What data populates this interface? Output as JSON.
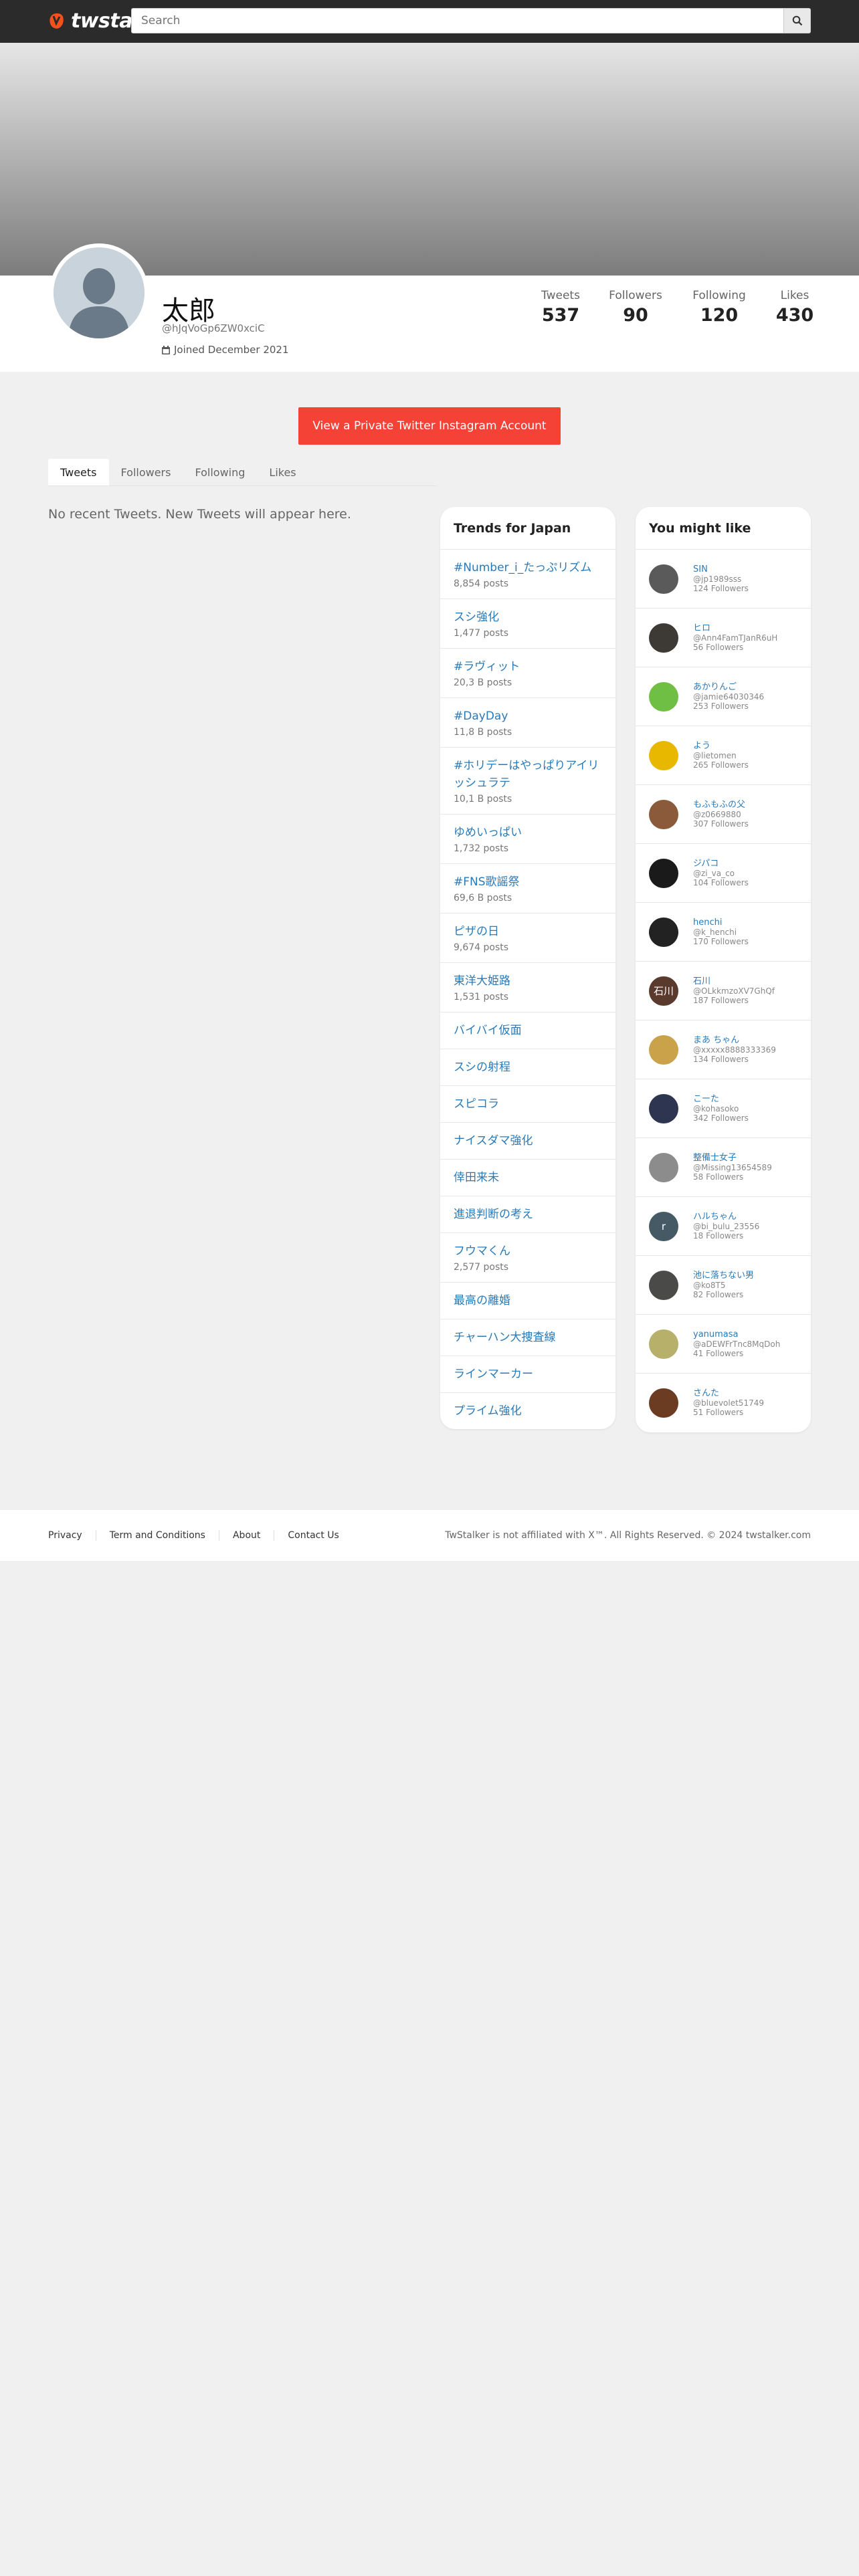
{
  "nav": {
    "logo_text": "twstalker",
    "search_placeholder": "Search",
    "brand_color": "#f4511e"
  },
  "profile": {
    "name": "太郎",
    "handle": "@hJqVoGp6ZW0xciC",
    "joined": "Joined December 2021",
    "stats": [
      {
        "label": "Tweets",
        "value": "537"
      },
      {
        "label": "Followers",
        "value": "90"
      },
      {
        "label": "Following",
        "value": "120"
      },
      {
        "label": "Likes",
        "value": "430"
      }
    ]
  },
  "cta": {
    "label": "View a Private Twitter Instagram Account",
    "color": "#f44336"
  },
  "tabs": [
    {
      "label": "Tweets",
      "active": true
    },
    {
      "label": "Followers",
      "active": false
    },
    {
      "label": "Following",
      "active": false
    },
    {
      "label": "Likes",
      "active": false
    }
  ],
  "timeline": {
    "empty_message": "No recent Tweets. New Tweets will appear here."
  },
  "trends": {
    "title": "Trends for Japan",
    "items": [
      {
        "name": "#Number_i_たっぷリズム",
        "posts": "8,854 posts"
      },
      {
        "name": "スシ強化",
        "posts": "1,477 posts"
      },
      {
        "name": "#ラヴィット",
        "posts": "20,3 B posts"
      },
      {
        "name": "#DayDay",
        "posts": "11,8 B posts"
      },
      {
        "name": "#ホリデーはやっぱりアイリッシュラテ",
        "posts": "10,1 B posts"
      },
      {
        "name": "ゆめいっぱい",
        "posts": "1,732 posts"
      },
      {
        "name": "#FNS歌謡祭",
        "posts": "69,6 B posts"
      },
      {
        "name": "ピザの日",
        "posts": "9,674 posts"
      },
      {
        "name": "東洋大姫路",
        "posts": "1,531 posts"
      },
      {
        "name": "バイバイ仮面",
        "posts": ""
      },
      {
        "name": "スシの射程",
        "posts": ""
      },
      {
        "name": "スピコラ",
        "posts": ""
      },
      {
        "name": "ナイスダマ強化",
        "posts": ""
      },
      {
        "name": "倖田来未",
        "posts": ""
      },
      {
        "name": "進退判断の考え",
        "posts": ""
      },
      {
        "name": "フウマくん",
        "posts": "2,577 posts"
      },
      {
        "name": "最高の離婚",
        "posts": ""
      },
      {
        "name": "チャーハン大捜査線",
        "posts": ""
      },
      {
        "name": "ラインマーカー",
        "posts": ""
      },
      {
        "name": "プライム強化",
        "posts": ""
      }
    ]
  },
  "suggestions": {
    "title": "You might like",
    "users": [
      {
        "name": "SIN",
        "handle": "@jp1989sss",
        "followers": "124 Followers",
        "avatar_color": "#5a5a5a",
        "initial": ""
      },
      {
        "name": "ヒロ",
        "handle": "@Ann4FamTJanR6uH",
        "followers": "56 Followers",
        "avatar_color": "#3d3a36",
        "initial": ""
      },
      {
        "name": "あかりんご",
        "handle": "@jamie64030346",
        "followers": "253 Followers",
        "avatar_color": "#6fbf45",
        "initial": ""
      },
      {
        "name": "よう",
        "handle": "@lietomen",
        "followers": "265 Followers",
        "avatar_color": "#e8b800",
        "initial": ""
      },
      {
        "name": "もふもふの父",
        "handle": "@z0669880",
        "followers": "307 Followers",
        "avatar_color": "#8a5a3a",
        "initial": ""
      },
      {
        "name": "ジパコ",
        "handle": "@zi_va_co",
        "followers": "104 Followers",
        "avatar_color": "#1a1a1a",
        "initial": ""
      },
      {
        "name": "henchi",
        "handle": "@k_henchi",
        "followers": "170 Followers",
        "avatar_color": "#222222",
        "initial": ""
      },
      {
        "name": "石川",
        "handle": "@OLkkmzoXV7GhQf",
        "followers": "187 Followers",
        "avatar_color": "#5b3a2e",
        "initial": "石川"
      },
      {
        "name": "まあ ちゃん",
        "handle": "@xxxxx8888333369",
        "followers": "134 Followers",
        "avatar_color": "#c9a24a",
        "initial": ""
      },
      {
        "name": "こーた",
        "handle": "@kohasoko",
        "followers": "342 Followers",
        "avatar_color": "#2d3550",
        "initial": ""
      },
      {
        "name": "整備士女子",
        "handle": "@Missing13654589",
        "followers": "58 Followers",
        "avatar_color": "#8c8c8c",
        "initial": ""
      },
      {
        "name": "ハルちゃん",
        "handle": "@bi_bulu_23556",
        "followers": "18 Followers",
        "avatar_color": "#455a64",
        "initial": "r"
      },
      {
        "name": "池に落ちない男",
        "handle": "@ko8T5",
        "followers": "82 Followers",
        "avatar_color": "#4a4a48",
        "initial": ""
      },
      {
        "name": "yanumasa",
        "handle": "@aDEWFrTnc8MqDoh",
        "followers": "41 Followers",
        "avatar_color": "#b6b06a",
        "initial": ""
      },
      {
        "name": "さんた",
        "handle": "@bluevolet51749",
        "followers": "51 Followers",
        "avatar_color": "#6b3b22",
        "initial": ""
      }
    ]
  },
  "footer": {
    "links": [
      "Privacy",
      "Term and Conditions",
      "About",
      "Contact Us"
    ],
    "copyright": "TwStalker is not affiliated with X™. All Rights Reserved. © 2024 twstalker.com"
  }
}
